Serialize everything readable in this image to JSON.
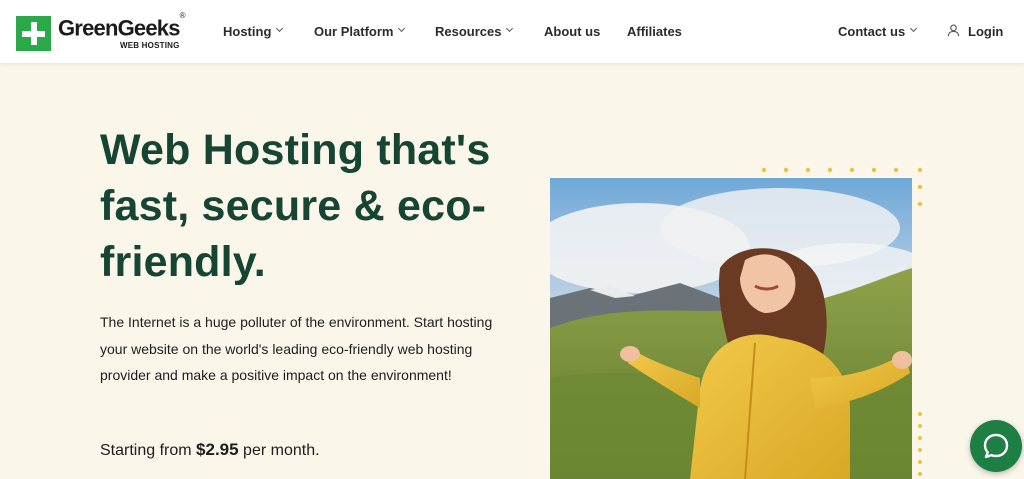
{
  "brand": {
    "name": "GreenGeeks",
    "trademark": "®",
    "tagline": "WEB HOSTING"
  },
  "nav": {
    "hosting": "Hosting",
    "platform": "Our Platform",
    "resources": "Resources",
    "about": "About us",
    "affiliates": "Affiliates",
    "contact": "Contact us",
    "login": "Login"
  },
  "hero": {
    "title": "Web Hosting that's fast, secure & eco-friendly.",
    "description": "The Internet is a huge polluter of the environment. Start hosting your website on the world's leading eco-friendly web hosting provider and make a positive impact on the environment!",
    "price_prefix": "Starting from",
    "price": "$2.95",
    "price_suffix": "per month."
  },
  "colors": {
    "brand_green": "#2aa84a",
    "heading_green": "#164533",
    "background": "#faf6ea",
    "accent_yellow": "#efc236",
    "chat_green": "#1e7f44"
  },
  "icons": [
    "user-icon",
    "chevron-down-icon",
    "chat-icon"
  ]
}
